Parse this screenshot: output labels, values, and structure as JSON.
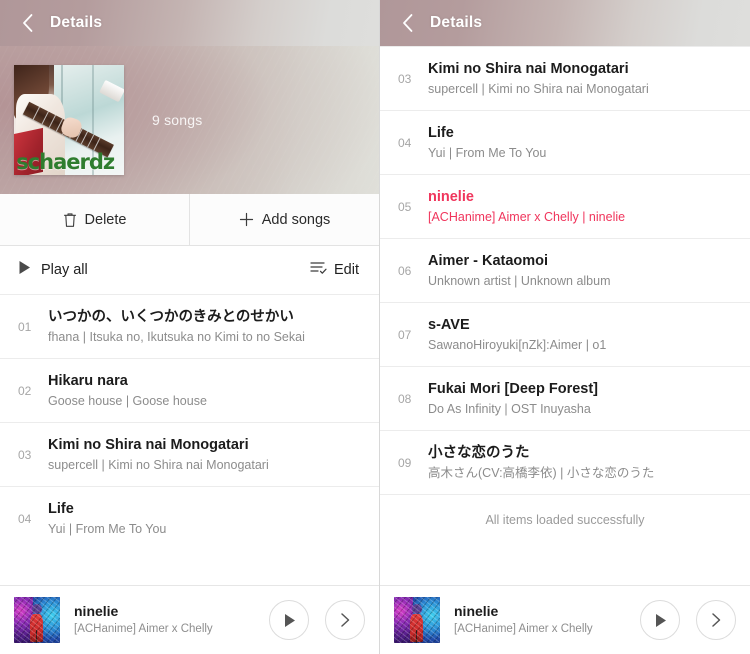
{
  "app": {
    "back_icon": "chevron-left-icon",
    "title": "Details"
  },
  "left_panel": {
    "header": {
      "back_icon": "chevron-left-icon",
      "title": "Details"
    },
    "hero": {
      "album_art_name": "schaerdz",
      "album_art_caption": "schaerdz",
      "song_count": "9 songs"
    },
    "actions": [
      {
        "icon": "trash-icon",
        "label": "Delete"
      },
      {
        "icon": "plus-icon",
        "label": "Add songs"
      }
    ],
    "play_row": {
      "play_icon": "play-triangle-icon",
      "play_label": "Play all",
      "edit_icon": "edit-list-icon",
      "edit_label": "Edit"
    },
    "tracks": [
      {
        "num": "01",
        "title": "いつかの、いくつかのきみとのせかい",
        "sub": "fhana | Itsuka no, Ikutsuka no Kimi to no Sekai",
        "playing": false
      },
      {
        "num": "02",
        "title": "Hikaru nara",
        "sub": "Goose house | Goose house",
        "playing": false
      },
      {
        "num": "03",
        "title": "Kimi no Shira nai Monogatari",
        "sub": "supercell | Kimi no Shira nai Monogatari",
        "playing": false
      },
      {
        "num": "04",
        "title": "Life",
        "sub": "Yui | From Me To You",
        "playing": false
      }
    ],
    "player": {
      "art_name": "ninelie-cover",
      "title": "ninelie",
      "sub": "[ACHanime] Aimer x Chelly",
      "play_icon": "play-triangle-icon",
      "next_icon": "chevron-right-icon"
    },
    "ghost": {
      "title": "ninelie",
      "sub": "[ACHanime] Aimer x Chelly | ninelie"
    }
  },
  "right_panel": {
    "header": {
      "back_icon": "chevron-left-icon",
      "title": "Details"
    },
    "tracks": [
      {
        "num": "03",
        "title": "Kimi no Shira nai Monogatari",
        "sub": "supercell | Kimi no Shira nai Monogatari",
        "playing": false
      },
      {
        "num": "04",
        "title": "Life",
        "sub": "Yui | From Me To You",
        "playing": false
      },
      {
        "num": "05",
        "title": "ninelie",
        "sub": "[ACHanime] Aimer x Chelly | ninelie",
        "playing": true
      },
      {
        "num": "06",
        "title": "Aimer - Kataomoi",
        "sub": "Unknown artist | Unknown album",
        "playing": false
      },
      {
        "num": "07",
        "title": "s-AVE",
        "sub": "SawanoHiroyuki[nZk]:Aimer | o1",
        "playing": false
      },
      {
        "num": "08",
        "title": "Fukai Mori [Deep Forest]",
        "sub": "Do As Infinity | OST Inuyasha",
        "playing": false
      },
      {
        "num": "09",
        "title": "小さな恋のうた",
        "sub": "高木さん(CV:高橋李依) | 小さな恋のうた",
        "playing": false
      }
    ],
    "footer": "All items loaded successfully",
    "player": {
      "art_name": "ninelie-cover",
      "title": "ninelie",
      "sub": "[ACHanime] Aimer x Chelly",
      "play_icon": "play-triangle-icon",
      "next_icon": "chevron-right-icon"
    }
  },
  "colors": {
    "accent_playing": "#f0355c",
    "header_start": "#b09799",
    "header_end": "#dededc",
    "title_text": "#1c1c1c",
    "sub_text": "#8c8c8c"
  }
}
